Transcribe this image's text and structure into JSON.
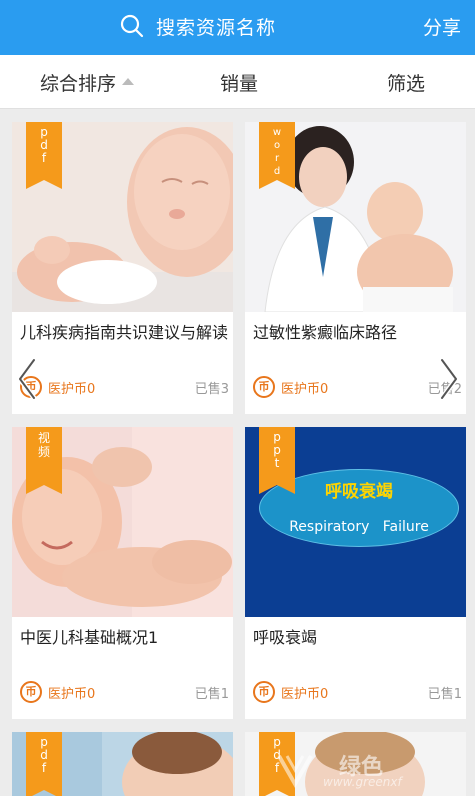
{
  "search": {
    "placeholder": "搜索资源名称"
  },
  "header": {
    "share_label": "分享"
  },
  "filters": [
    {
      "label": "综合排序"
    },
    {
      "label": "销量"
    },
    {
      "label": "筛选"
    }
  ],
  "cards": [
    {
      "tag": "pdf",
      "title": "儿科疾病指南共识建议与解读",
      "price": "医护币0",
      "sold": "已售3"
    },
    {
      "tag": "word",
      "title": "过敏性紫癜临床路径",
      "price": "医护币0",
      "sold": "已售2"
    },
    {
      "tag": "视频",
      "title": "中医儿科基础概况1",
      "price": "医护币0",
      "sold": "已售1"
    },
    {
      "tag": "ppt",
      "title": "呼吸衰竭",
      "price": "医护币0",
      "sold": "已售1",
      "slide_title": "呼吸衰竭",
      "slide_subtitle": "Respiratory   Failure"
    },
    {
      "tag": "pdf"
    },
    {
      "tag": "pdf"
    }
  ],
  "coin_symbol": "币",
  "watermark": {
    "text": "绿色",
    "url": "www.greenxf"
  },
  "colors": {
    "primary": "#2a9cf0",
    "tag": "#f59a1b",
    "coin": "#e8761c"
  }
}
